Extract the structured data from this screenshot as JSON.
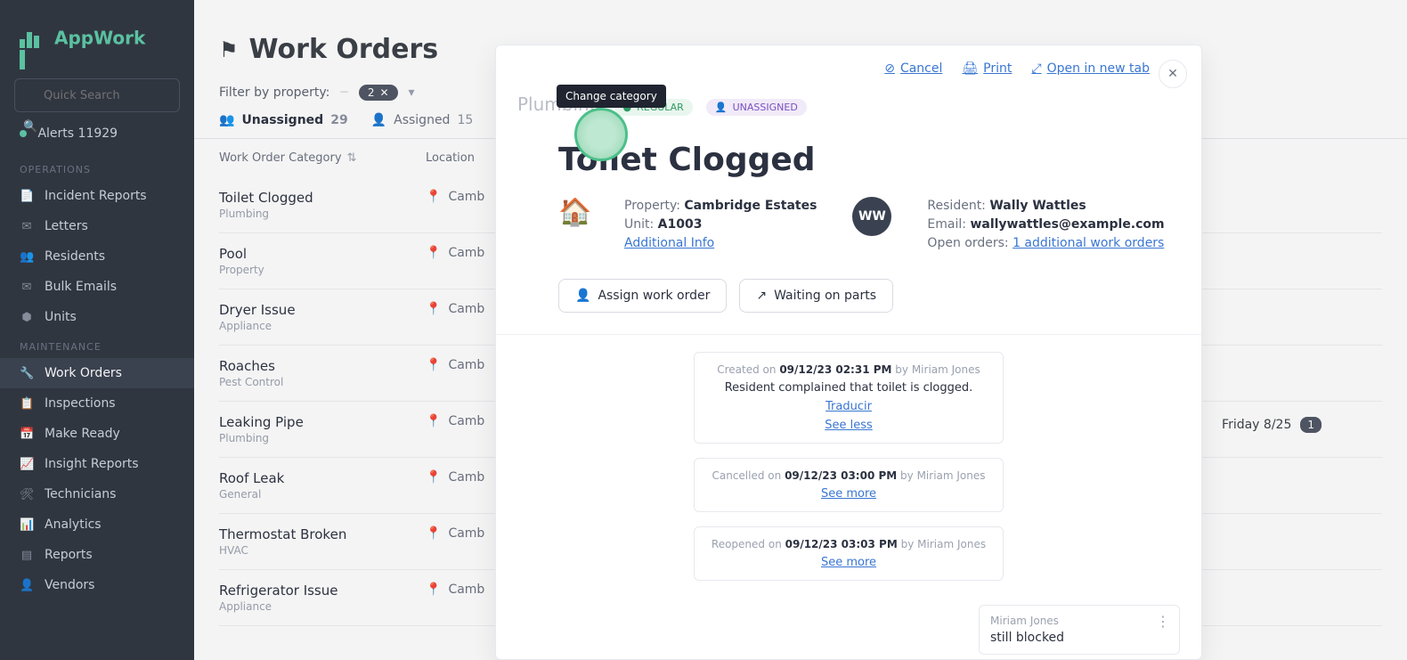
{
  "brand": {
    "name": "AppWork"
  },
  "search": {
    "placeholder": "Quick Search"
  },
  "alerts": {
    "label": "Alerts",
    "count": "11929"
  },
  "nav": {
    "operations_head": "OPERATIONS",
    "maintenance_head": "MAINTENANCE",
    "ops": [
      {
        "label": "Incident Reports",
        "icon": "📄"
      },
      {
        "label": "Letters",
        "icon": "✉"
      },
      {
        "label": "Residents",
        "icon": "👥"
      },
      {
        "label": "Bulk Emails",
        "icon": "✉"
      },
      {
        "label": "Units",
        "icon": "⬢"
      }
    ],
    "maint": [
      {
        "label": "Work Orders",
        "icon": "🔧"
      },
      {
        "label": "Inspections",
        "icon": "📋"
      },
      {
        "label": "Make Ready",
        "icon": "📅"
      },
      {
        "label": "Insight Reports",
        "icon": "📈"
      },
      {
        "label": "Technicians",
        "icon": "🛠"
      },
      {
        "label": "Analytics",
        "icon": "📊"
      },
      {
        "label": "Reports",
        "icon": "▤"
      },
      {
        "label": "Vendors",
        "icon": "👤"
      }
    ]
  },
  "page": {
    "title": "Work Orders"
  },
  "filter": {
    "label": "Filter by property:",
    "chip": "2"
  },
  "tabs": {
    "unassigned": {
      "label": "Unassigned",
      "count": "29"
    },
    "assigned": {
      "label": "Assigned",
      "count": "15"
    }
  },
  "cols": {
    "cat": "Work Order Category",
    "loc": "Location"
  },
  "rows": [
    {
      "title": "Toilet Clogged",
      "sub": "Plumbing",
      "loc": "Camb"
    },
    {
      "title": "Pool",
      "sub": "Property",
      "loc": "Camb"
    },
    {
      "title": "Dryer Issue",
      "sub": "Appliance",
      "loc": "Camb"
    },
    {
      "title": "Roaches",
      "sub": "Pest Control",
      "loc": "Camb"
    },
    {
      "title": "Leaking Pipe",
      "sub": "Plumbing",
      "loc": "Camb"
    },
    {
      "title": "Roof Leak",
      "sub": "General",
      "loc": "Camb"
    },
    {
      "title": "Thermostat Broken",
      "sub": "HVAC",
      "loc": "Camb"
    },
    {
      "title": "Refrigerator Issue",
      "sub": "Appliance",
      "loc": "Camb"
    }
  ],
  "modal": {
    "top": {
      "cancel": "Cancel",
      "print": "Print",
      "open_tab": "Open in new tab"
    },
    "tooltip": "Change category",
    "crumb": "Plumbing",
    "badge_reg": "REGULAR",
    "badge_un": "UNASSIGNED",
    "title": "Toilet Clogged",
    "property_label": "Property:",
    "property_val": "Cambridge Estates",
    "unit_label": "Unit:",
    "unit_val": "A1003",
    "addl_info": "Additional Info",
    "avatar": "WW",
    "resident_label": "Resident:",
    "resident_val": "Wally Wattles",
    "email_label": "Email:",
    "email_val": "wallywattles@example.com",
    "open_orders_label": "Open orders:",
    "open_orders_link": "1 additional work orders",
    "assign_btn": "Assign work order",
    "waiting_btn": "Waiting on parts",
    "feed": {
      "created": {
        "pre": "Created on",
        "date": "09/12/23 02:31 PM",
        "by": "by Miriam Jones",
        "body": "Resident complained that toilet is clogged.",
        "translate": "Traducir",
        "toggle": "See less"
      },
      "cancelled": {
        "pre": "Cancelled on",
        "date": "09/12/23 03:00 PM",
        "by": "by Miriam Jones",
        "toggle": "See more"
      },
      "reopened": {
        "pre": "Reopened on",
        "date": "09/12/23 03:03 PM",
        "by": "by Miriam Jones",
        "toggle": "See more"
      }
    },
    "comment": {
      "who": "Miriam Jones",
      "txt": "still blocked"
    }
  },
  "friday": {
    "label": "Friday 8/25",
    "count": "1"
  }
}
